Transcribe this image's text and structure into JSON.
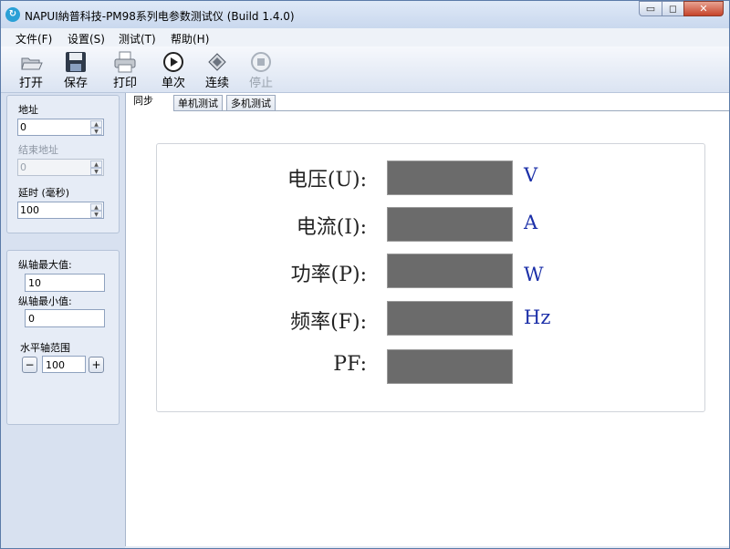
{
  "window": {
    "title": "NAPUI納普科技-PM98系列电参数测试仪 (Build 1.4.0)",
    "controls": {
      "minimize": "▭",
      "maximize": "◻",
      "close": "✕"
    }
  },
  "menu": [
    "文件(F)",
    "设置(S)",
    "测试(T)",
    "帮助(H)"
  ],
  "toolbar": {
    "open": "打开",
    "save": "保存",
    "print": "打印",
    "single": "单次",
    "continuous": "连续",
    "stop": "停止"
  },
  "left_panel": {
    "address_label": "地址",
    "address_value": "0",
    "end_address_label": "结束地址",
    "end_address_value": "0",
    "delay_label": "延时 (毫秒)",
    "delay_value": "100",
    "y_max_label": "纵轴最大值:",
    "y_max_value": "10",
    "y_min_label": "纵轴最小值:",
    "y_min_value": "0",
    "x_range_label": "水平轴范围",
    "x_range_value": "100",
    "minus": "−",
    "plus": "+"
  },
  "tabs": [
    "同步",
    "单机测试",
    "多机测试"
  ],
  "measurements": [
    {
      "label": "电压(U):",
      "value": "",
      "unit": "V"
    },
    {
      "label": "电流(I):",
      "value": "",
      "unit": "A"
    },
    {
      "label": "功率(P):",
      "value": "",
      "unit": "W"
    },
    {
      "label": "频率(F):",
      "value": "",
      "unit": "Hz"
    },
    {
      "label": "PF:",
      "value": "",
      "unit": ""
    }
  ],
  "colors": {
    "display_bg": "#6b6b6b",
    "unit_text": "#1b2fa8",
    "window_frame": "#5b7ba8"
  }
}
